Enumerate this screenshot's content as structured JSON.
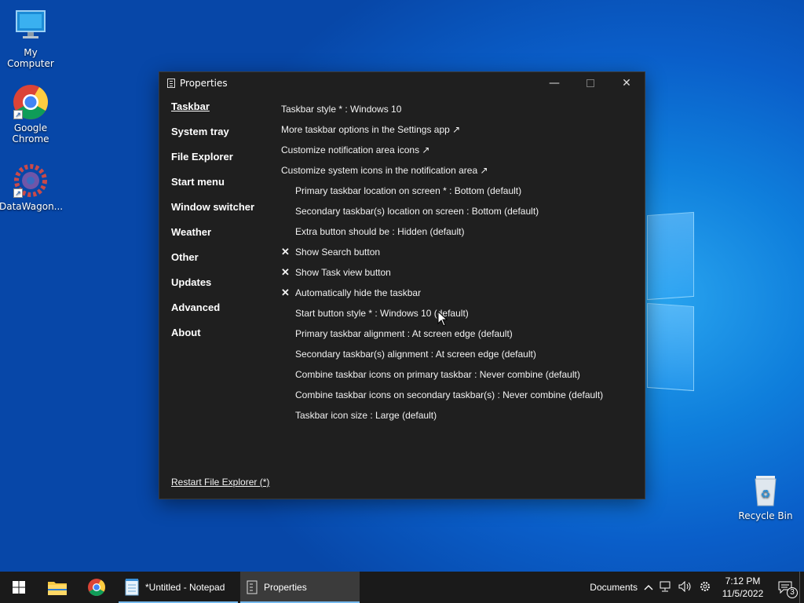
{
  "desktop": {
    "icons": [
      {
        "label": "My Computer"
      },
      {
        "label": "Google Chrome"
      },
      {
        "label": "DataWagon..."
      },
      {
        "label": "Recycle Bin"
      }
    ]
  },
  "window": {
    "title": "Properties",
    "sidebar": [
      "Taskbar",
      "System tray",
      "File Explorer",
      "Start menu",
      "Window switcher",
      "Weather",
      "Other",
      "Updates",
      "Advanced",
      "About"
    ],
    "options": [
      {
        "text": "Taskbar style * : Windows 10",
        "check": ""
      },
      {
        "text": "More taskbar options in the Settings app ↗",
        "check": ""
      },
      {
        "text": "Customize notification area icons ↗",
        "check": ""
      },
      {
        "text": "Customize system icons in the notification area ↗",
        "check": ""
      },
      {
        "text": "Primary taskbar location on screen * : Bottom (default)",
        "check": ""
      },
      {
        "text": "Secondary taskbar(s) location on screen : Bottom (default)",
        "check": ""
      },
      {
        "text": "Extra button should be : Hidden (default)",
        "check": ""
      },
      {
        "text": "Show Search button",
        "check": "✕"
      },
      {
        "text": "Show Task view button",
        "check": "✕"
      },
      {
        "text": "Automatically hide the taskbar",
        "check": "✕"
      },
      {
        "text": "Start button style * : Windows 10 (default)",
        "check": ""
      },
      {
        "text": "Primary taskbar alignment : At screen edge (default)",
        "check": ""
      },
      {
        "text": "Secondary taskbar(s) alignment : At screen edge (default)",
        "check": ""
      },
      {
        "text": "Combine taskbar icons on primary taskbar : Never combine (default)",
        "check": ""
      },
      {
        "text": "Combine taskbar icons on secondary taskbar(s) : Never combine (default)",
        "check": ""
      },
      {
        "text": "Taskbar icon size : Large (default)",
        "check": ""
      }
    ],
    "restart_link": "Restart File Explorer (*)"
  },
  "taskbar": {
    "tasks": [
      {
        "label": "*Untitled - Notepad"
      },
      {
        "label": "Properties"
      }
    ],
    "tray": {
      "toolbar_label": "Documents",
      "time": "7:12 PM",
      "date": "11/5/2022",
      "notification_count": "3"
    }
  },
  "colors": {
    "accent": "#76b9ed",
    "window_bg": "#1f1f1f",
    "taskbar_bg": "#1a1a1a"
  }
}
